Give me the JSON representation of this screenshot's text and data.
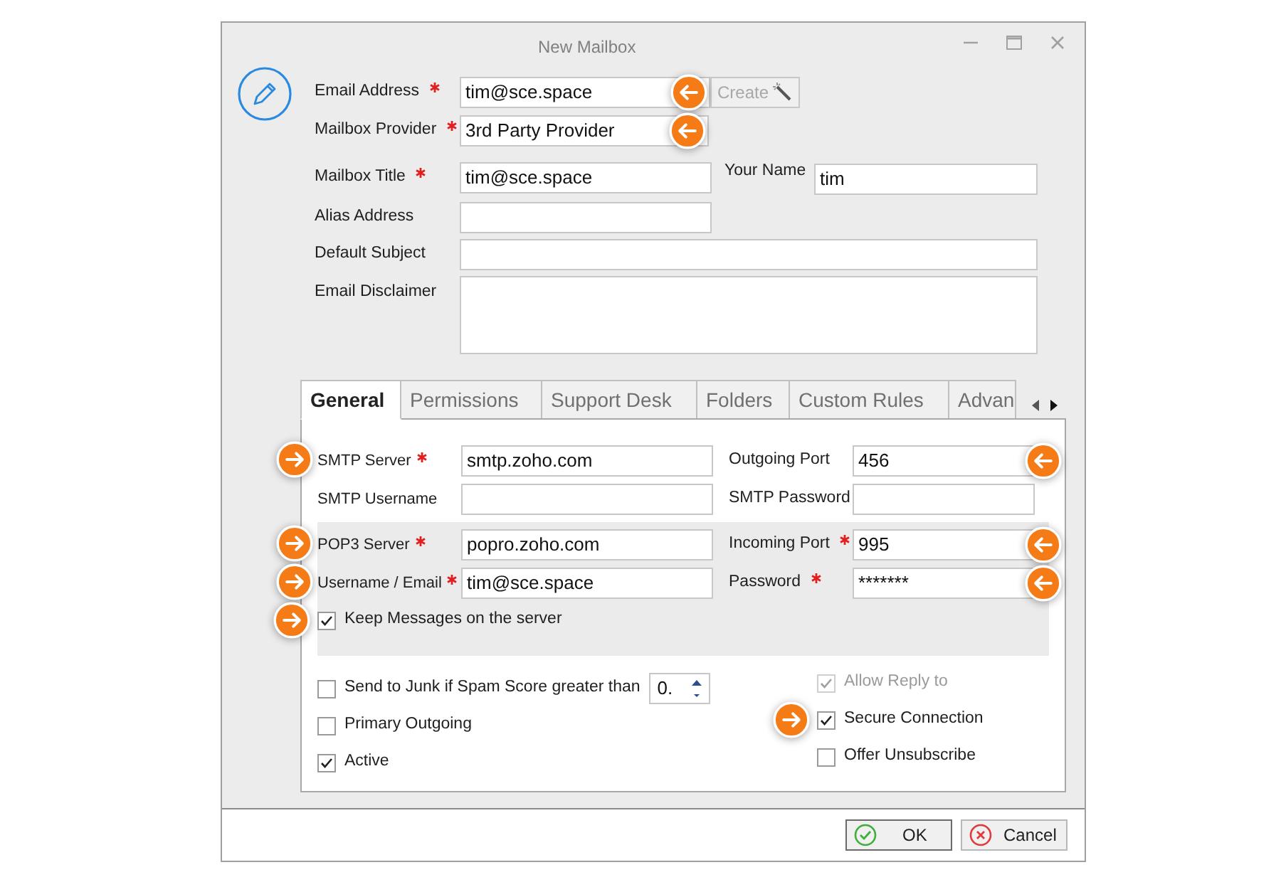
{
  "window": {
    "title": "New Mailbox"
  },
  "header_rows": [
    {
      "kind": "create",
      "label": "Email Address",
      "required": true,
      "value": "tim@sce.space",
      "callout": true,
      "button": {
        "label": "Create",
        "disabled": true
      }
    },
    {
      "kind": "dropdown",
      "label": "Mailbox Provider",
      "required": true,
      "value": "3rd Party Provider",
      "callout": true
    },
    {
      "kind": "text",
      "label": "Mailbox Title",
      "required": true,
      "value": "tim@sce.space",
      "side": {
        "label": "Your Name",
        "value": "tim"
      }
    },
    {
      "kind": "text",
      "label": "Alias Address",
      "required": false
    },
    {
      "kind": "wide",
      "label": "Default Subject",
      "required": false
    },
    {
      "kind": "area",
      "label": "Email Disclaimer",
      "required": false
    }
  ],
  "tabs": [
    {
      "label": "General",
      "selected": true
    },
    {
      "label": "Permissions",
      "selected": false
    },
    {
      "label": "Support Desk",
      "selected": false
    },
    {
      "label": "Folders",
      "selected": false
    },
    {
      "label": "Custom Rules",
      "selected": false
    },
    {
      "label": "Advan",
      "selected": false
    }
  ],
  "general_rows": [
    {
      "left": {
        "label": "SMTP Server",
        "required": true,
        "value": "smtp.zoho.com",
        "callout": true
      },
      "right": {
        "label": "Outgoing Port",
        "required": false,
        "value": "456",
        "callout": true
      }
    },
    {
      "left": {
        "label": "SMTP Username",
        "required": false
      },
      "right": {
        "label": "SMTP Password",
        "required": false
      }
    },
    {
      "left": {
        "label": "POP3 Server",
        "required": true,
        "value": "popro.zoho.com",
        "callout": true
      },
      "right": {
        "label": "Incoming Port",
        "required": true,
        "value": "995",
        "callout": true
      }
    },
    {
      "left": {
        "label": "Username / Email",
        "required": true,
        "value": "tim@sce.space",
        "callout": true
      },
      "right": {
        "label": "Password",
        "required": true,
        "value": "*******",
        "callout": true
      }
    }
  ],
  "keep_messages": {
    "label": "Keep Messages on the server",
    "checked": true,
    "callout": true
  },
  "options_left": [
    {
      "label": "Send to Junk if Spam Score greater than",
      "checked": false,
      "disabled": false,
      "spin_value": "0."
    },
    {
      "label": "Primary Outgoing",
      "checked": false,
      "disabled": false
    },
    {
      "label": "Active",
      "checked": true,
      "disabled": false
    }
  ],
  "options_right": [
    {
      "label": "Allow Reply to",
      "checked": true,
      "disabled": true
    },
    {
      "label": "Secure Connection",
      "checked": true,
      "disabled": false,
      "callout": true
    },
    {
      "label": "Offer Unsubscribe",
      "checked": false,
      "disabled": false
    }
  ],
  "buttons": [
    {
      "kind": "ok",
      "label": "OK"
    },
    {
      "kind": "cancel",
      "label": "Cancel"
    }
  ]
}
